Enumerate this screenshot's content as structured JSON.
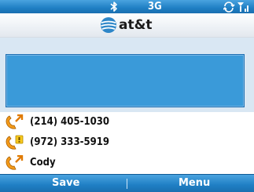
{
  "status_bar": {
    "network": "3G",
    "icons": [
      "bluetooth-icon",
      "data-connection-icon",
      "signal-strength-icon"
    ]
  },
  "header": {
    "carrier": "at&t"
  },
  "calls": [
    {
      "number": "(214) 405-1030",
      "icon": "outgoing-call-icon"
    },
    {
      "number": "(972) 333-5919",
      "icon": "missed-call-icon"
    },
    {
      "number": "Cody",
      "icon": "outgoing-call-icon"
    }
  ],
  "softkeys": {
    "left": "Save",
    "right": "Menu"
  },
  "colors": {
    "accent": "#1f7fc4",
    "info_box": "#3a9ad9",
    "panel": "#d9e7f3",
    "call_icon": "#f39a1a"
  }
}
